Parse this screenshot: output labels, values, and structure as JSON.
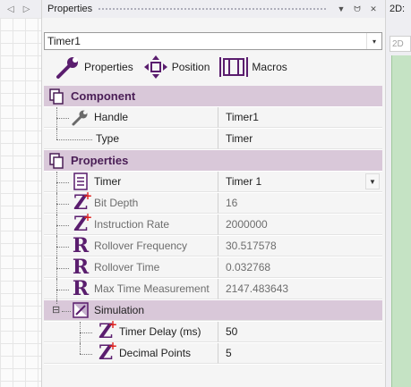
{
  "left_panel": {
    "tab_prev": "◁",
    "tab_next": "▷"
  },
  "panel": {
    "title": "Properties",
    "buttons": {
      "dropdown": "▼",
      "pin": "ᗢ",
      "close": "✕"
    },
    "component_selector": {
      "value": "Timer1",
      "arrow": "▾"
    },
    "toolbar": {
      "properties": "Properties",
      "position": "Position",
      "macros": "Macros"
    }
  },
  "grid": {
    "component_section": "Component",
    "component_rows": [
      {
        "name": "Handle",
        "value": "Timer1"
      },
      {
        "name": "Type",
        "value": "Timer"
      }
    ],
    "properties_section": "Properties",
    "properties_rows": [
      {
        "name": "Timer",
        "value": "Timer 1",
        "icon": "document-icon"
      },
      {
        "name": "Bit Depth",
        "value": "16",
        "icon": "z-plus-icon"
      },
      {
        "name": "Instruction Rate",
        "value": "2000000",
        "icon": "z-plus-icon"
      },
      {
        "name": "Rollover Frequency",
        "value": "30.517578",
        "icon": "r-icon"
      },
      {
        "name": "Rollover Time",
        "value": "0.032768",
        "icon": "r-icon"
      },
      {
        "name": "Max Time Measurement",
        "value": "2147.483643",
        "icon": "r-icon"
      }
    ],
    "simulation_group": {
      "name": "Simulation",
      "toggle": "⊟"
    },
    "simulation_rows": [
      {
        "name": "Timer Delay (ms)",
        "value": "50",
        "icon": "z-plus-icon"
      },
      {
        "name": "Decimal Points",
        "value": "5",
        "icon": "z-plus-icon"
      }
    ]
  },
  "right_panel": {
    "tab_label": "2D:",
    "tab2_label": "2D"
  },
  "colors": {
    "category_bg": "#d9c8d9",
    "category_text": "#4a1e56",
    "icon_purple": "#5a1d6e",
    "icon_red": "#e0201c",
    "canvas_green": "#c5e3c4"
  }
}
